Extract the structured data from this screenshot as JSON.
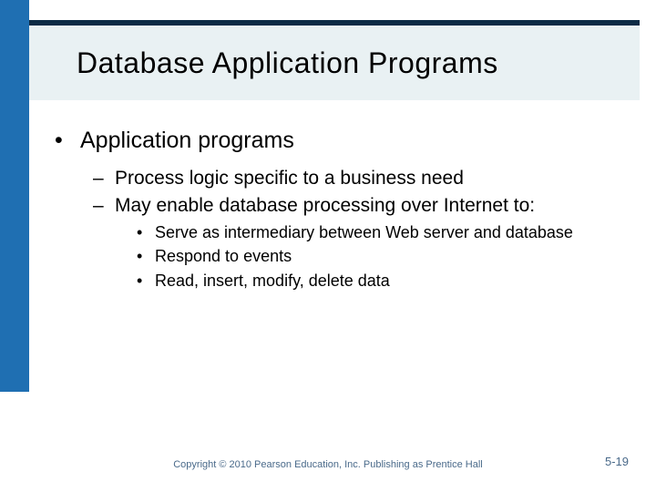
{
  "title": "Database Application Programs",
  "bullets": {
    "lvl1": "Application programs",
    "lvl2a": "Process logic specific to a business need",
    "lvl2b": "May enable database processing over Internet to:",
    "lvl3a": "Serve as intermediary between Web server and database",
    "lvl3b": "Respond to events",
    "lvl3c": "Read, insert, modify, delete data"
  },
  "footer": {
    "copyright": "Copyright © 2010 Pearson Education, Inc. Publishing as Prentice Hall",
    "page": "5-19"
  }
}
